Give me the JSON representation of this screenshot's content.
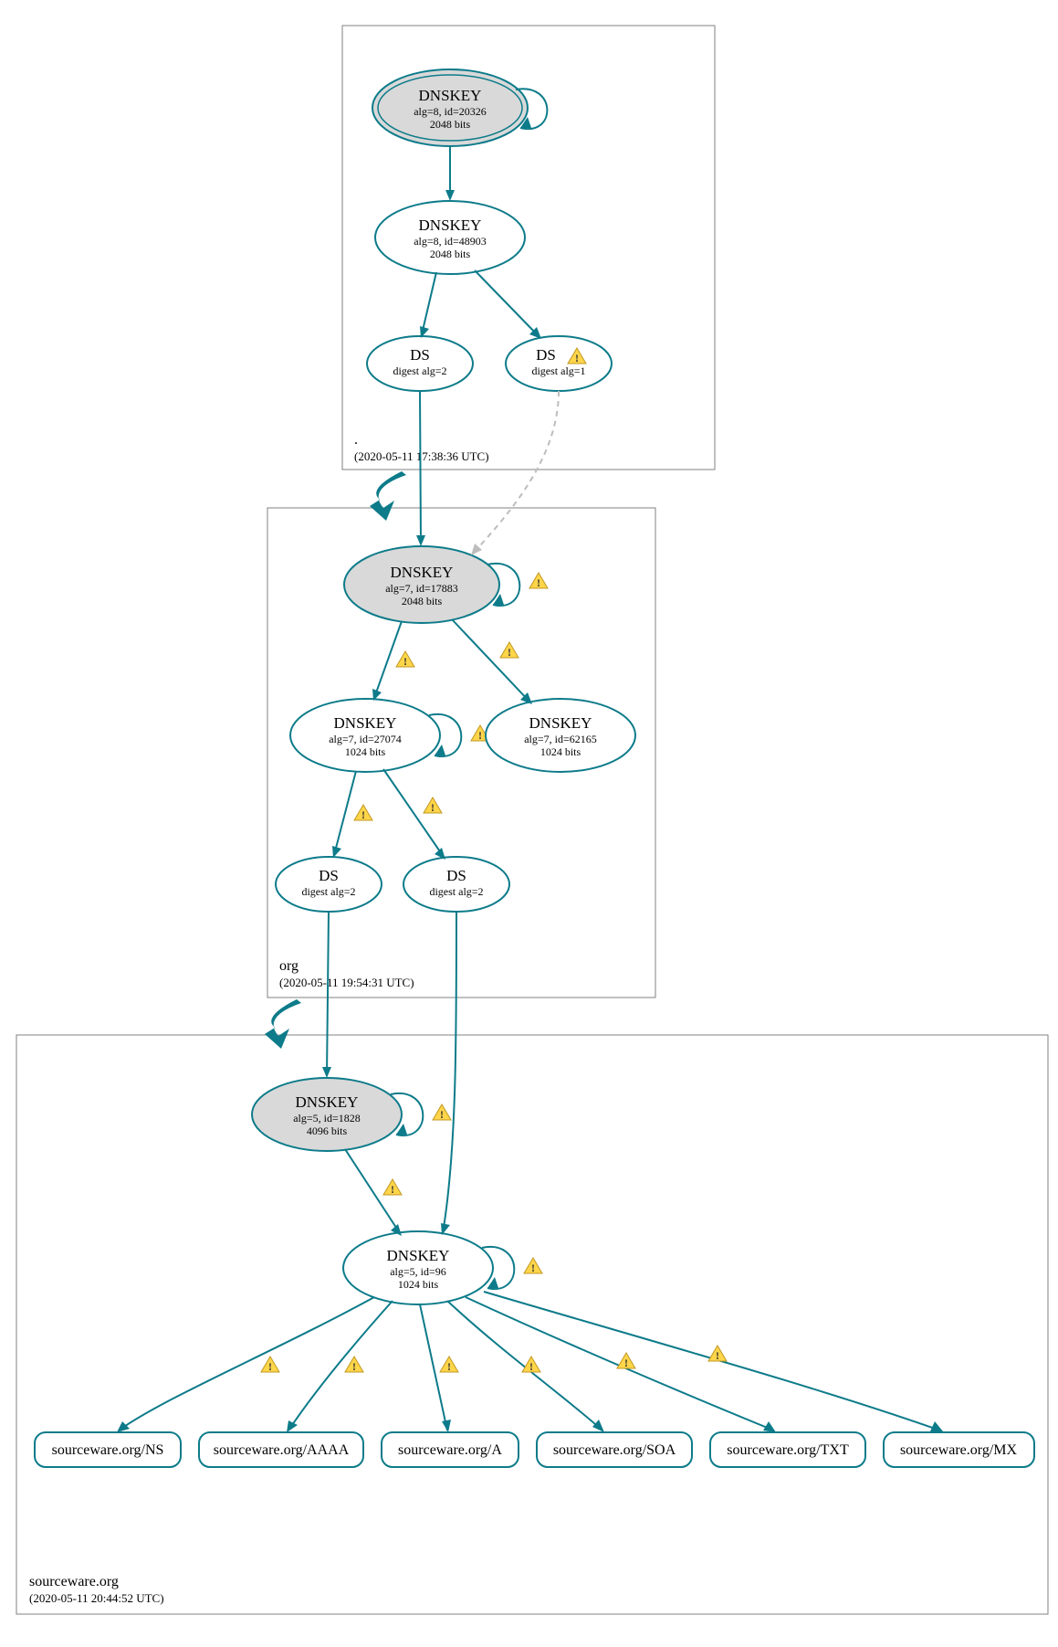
{
  "zones": {
    "root": {
      "label": ".",
      "timestamp": "(2020-05-11 17:38:36 UTC)"
    },
    "org": {
      "label": "org",
      "timestamp": "(2020-05-11 19:54:31 UTC)"
    },
    "sourceware": {
      "label": "sourceware.org",
      "timestamp": "(2020-05-11 20:44:52 UTC)"
    }
  },
  "nodes": {
    "root_ksk": {
      "title": "DNSKEY",
      "line2": "alg=8, id=20326",
      "line3": "2048 bits"
    },
    "root_zsk": {
      "title": "DNSKEY",
      "line2": "alg=8, id=48903",
      "line3": "2048 bits"
    },
    "root_ds2": {
      "title": "DS",
      "line2": "digest alg=2"
    },
    "root_ds1": {
      "title": "DS",
      "line2": "digest alg=1"
    },
    "org_ksk": {
      "title": "DNSKEY",
      "line2": "alg=7, id=17883",
      "line3": "2048 bits"
    },
    "org_zsk1": {
      "title": "DNSKEY",
      "line2": "alg=7, id=27074",
      "line3": "1024 bits"
    },
    "org_zsk2": {
      "title": "DNSKEY",
      "line2": "alg=7, id=62165",
      "line3": "1024 bits"
    },
    "org_ds_a": {
      "title": "DS",
      "line2": "digest alg=2"
    },
    "org_ds_b": {
      "title": "DS",
      "line2": "digest alg=2"
    },
    "sw_ksk": {
      "title": "DNSKEY",
      "line2": "alg=5, id=1828",
      "line3": "4096 bits"
    },
    "sw_zsk": {
      "title": "DNSKEY",
      "line2": "alg=5, id=96",
      "line3": "1024 bits"
    }
  },
  "records": {
    "ns": "sourceware.org/NS",
    "aaaa": "sourceware.org/AAAA",
    "a": "sourceware.org/A",
    "soa": "sourceware.org/SOA",
    "txt": "sourceware.org/TXT",
    "mx": "sourceware.org/MX"
  }
}
